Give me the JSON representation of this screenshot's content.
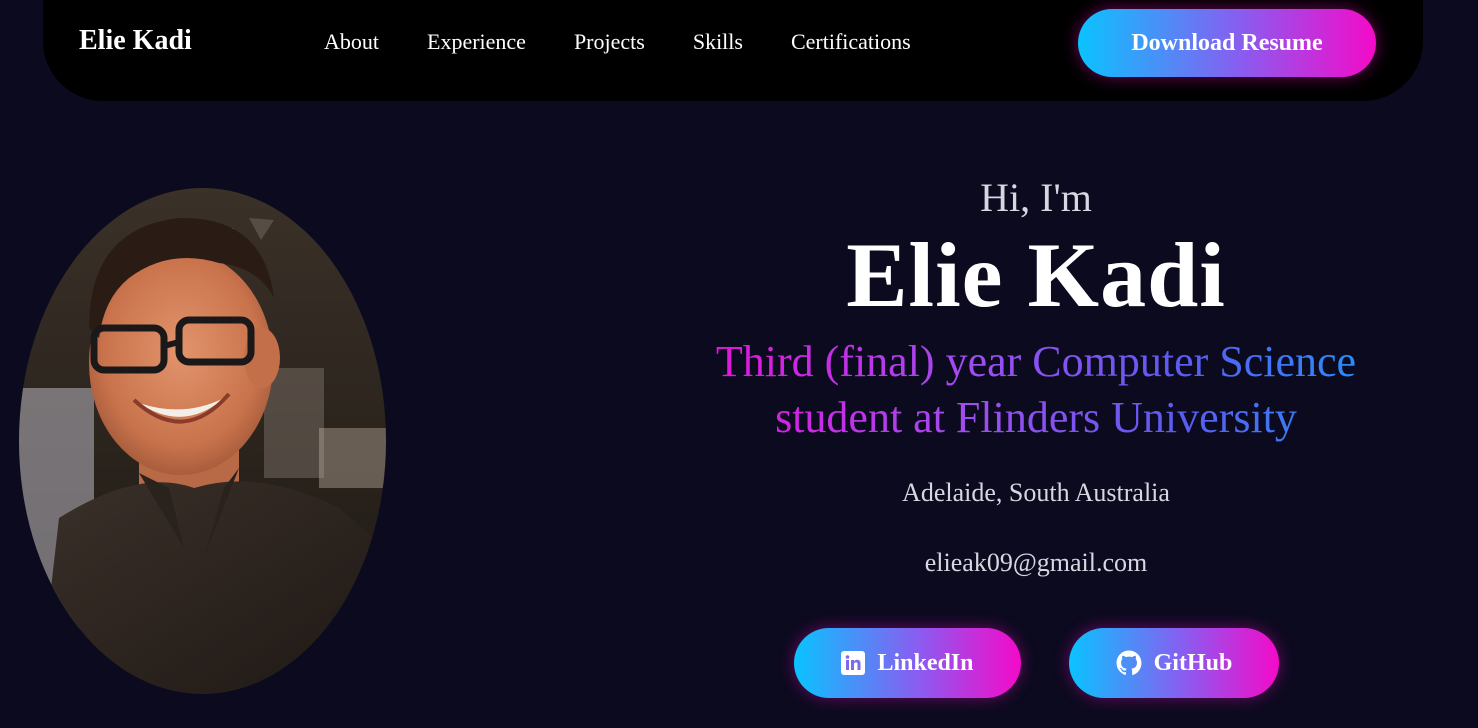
{
  "navbar": {
    "brand": "Elie Kadi",
    "links": [
      "About",
      "Experience",
      "Projects",
      "Skills",
      "Certifications"
    ],
    "resume_label": "Download Resume"
  },
  "hero": {
    "greeting": "Hi, I'm",
    "name": "Elie Kadi",
    "tagline": "Third (final) year Computer Science student at Flinders University",
    "location": "Adelaide, South Australia",
    "email": "elieak09@gmail.com"
  },
  "social": {
    "linkedin_label": "LinkedIn",
    "github_label": "GitHub"
  },
  "icons": {
    "linkedin": "linkedin-icon",
    "github": "github-icon"
  },
  "colors": {
    "background": "#0c0a1f",
    "navbar": "#000000",
    "gradient_start": "#0ac3ff",
    "gradient_end": "#f50ac8"
  }
}
